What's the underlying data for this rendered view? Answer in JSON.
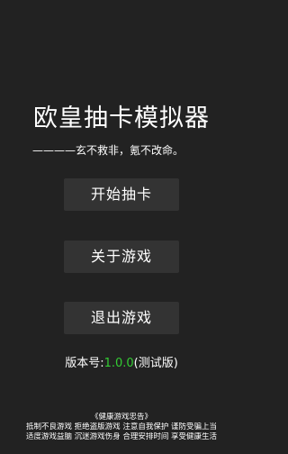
{
  "title": "欧皇抽卡模拟器",
  "motto": "————玄不救非，氪不改命。",
  "menu": {
    "start_label": "开始抽卡",
    "about_label": "关于游戏",
    "exit_label": "退出游戏"
  },
  "version": {
    "prefix": "版本号:",
    "number": "1.0.0",
    "suffix": "(测试版)"
  },
  "health_advisory": {
    "title": "《健康游戏忠告》",
    "line1": "抵制不良游戏 拒绝盗版游戏 注意自我保护 谨防受骗上当",
    "line2": "适度游戏益脑 沉迷游戏伤身 合理安排时间 享受健康生活"
  },
  "colors": {
    "background": "#222222",
    "button": "#333333",
    "version_number": "#33cc33"
  }
}
